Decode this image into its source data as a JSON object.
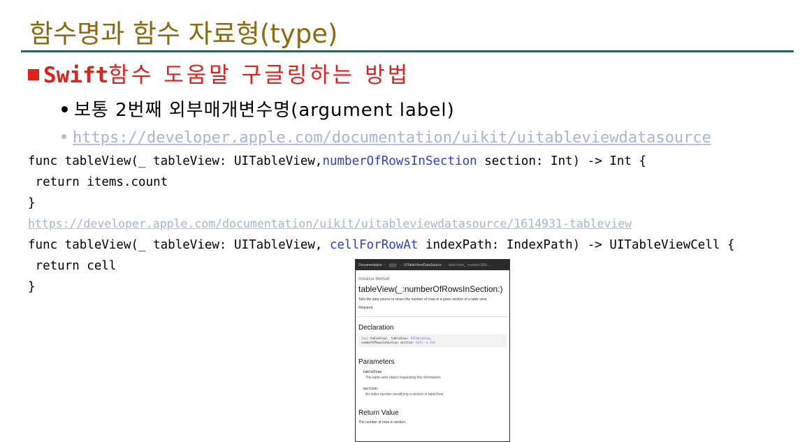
{
  "slide": {
    "title": "함수명과 함수 자료형(type)",
    "heading_code": "Swift",
    "heading_text": "함수 도움말 구글링하는 방법",
    "bullet1": "보통 2번째 외부매개변수명(argument label)",
    "bullet2_link": "https://developer.apple.com/documentation/uikit/uitableviewdatasource"
  },
  "code": {
    "line1_before": "func tableView(_ tableView: UITableView,",
    "line1_highlight": "numberOfRowsInSection",
    "line1_after": " section: Int) -> Int {",
    "line2": " return items.count",
    "line3": "}",
    "link2": "https://developer.apple.com/documentation/uikit/uitableviewdatasource/1614931-tableview",
    "line5_before": "func tableView(_ tableView: UITableView, ",
    "line5_highlight": "cellForRowAt",
    "line5_after": " indexPath: IndexPath) -> UITableViewCell {",
    "line6": " return cell",
    "line7": "}"
  },
  "doc_screenshot": {
    "breadcrumb_root": "Documentation",
    "breadcrumb_mid": "UITableViewDataSource",
    "breadcrumb_leaf": "tableView(_:numberOfRo...",
    "kind": "Instance Method",
    "title": "tableView(_:numberOfRowsInSection:)",
    "summary": "Tells the data source to return the number of rows in a given section of a table view.",
    "required": "Required.",
    "declaration_heading": "Declaration",
    "decl_kw": "func",
    "decl_a": " tableView(_ tableView: ",
    "decl_type1": "UITableView",
    "decl_b": ",",
    "decl_c": "numberOfRowsInSection section: ",
    "decl_type2": "Int",
    "decl_d": ") -> ",
    "decl_type3": "Int",
    "parameters_heading": "Parameters",
    "param1_name": "tableView",
    "param1_desc": "The table-view object requesting this information.",
    "param2_name": "section",
    "param2_desc": "An index number identifying a section in tableView.",
    "return_heading": "Return Value",
    "return_desc": "The number of rows in section."
  },
  "colors": {
    "title": "#8a6b12",
    "rule": "#2c6254",
    "heading": "#e0201b",
    "link": "#a9b3d6",
    "code_highlight": "#2f3fc9"
  }
}
